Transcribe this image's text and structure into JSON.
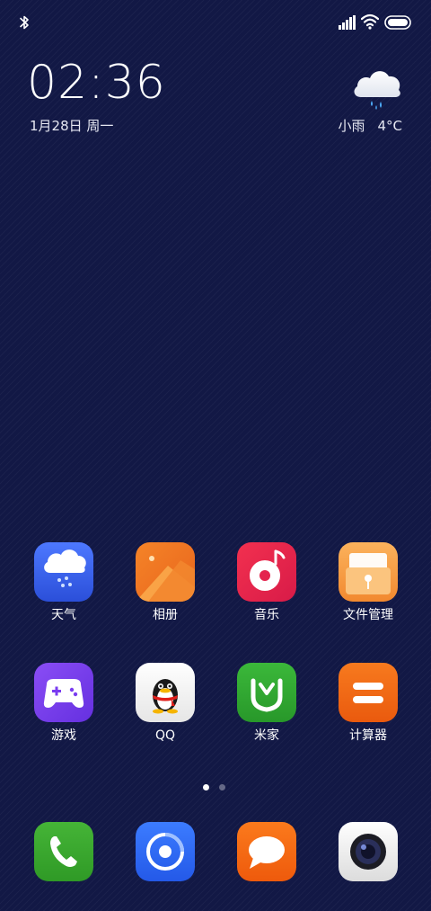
{
  "status_bar": {
    "icons": [
      "bluetooth-icon",
      "signal-icon",
      "wifi-icon",
      "battery-icon"
    ]
  },
  "clock": {
    "time": "02:36",
    "date": "1月28日 周一"
  },
  "weather": {
    "icon": "rain-cloud-icon",
    "condition": "小雨",
    "temperature": "4°C"
  },
  "apps": [
    {
      "label": "天气",
      "icon": "weather-app-icon",
      "color": "#3b64f0"
    },
    {
      "label": "相册",
      "icon": "gallery-app-icon",
      "color": "#f07020"
    },
    {
      "label": "音乐",
      "icon": "music-app-icon",
      "color": "#e8204a"
    },
    {
      "label": "文件管理",
      "icon": "file-manager-app-icon",
      "color": "#f79a3c"
    },
    {
      "label": "游戏",
      "icon": "games-app-icon",
      "color": "#7a3cf0"
    },
    {
      "label": "QQ",
      "icon": "qq-app-icon",
      "color": "#f2f2f2"
    },
    {
      "label": "米家",
      "icon": "mijia-app-icon",
      "color": "#2fa830"
    },
    {
      "label": "计算器",
      "icon": "calculator-app-icon",
      "color": "#f06a14"
    }
  ],
  "pagination": {
    "pages": 2,
    "current": 1
  },
  "dock": [
    {
      "icon": "phone-app-icon",
      "color": "#3aa82e"
    },
    {
      "icon": "browser-app-icon",
      "color": "#2f6cf2"
    },
    {
      "icon": "messages-app-icon",
      "color": "#f56a12"
    },
    {
      "icon": "camera-app-icon",
      "color": "#ececec"
    }
  ]
}
